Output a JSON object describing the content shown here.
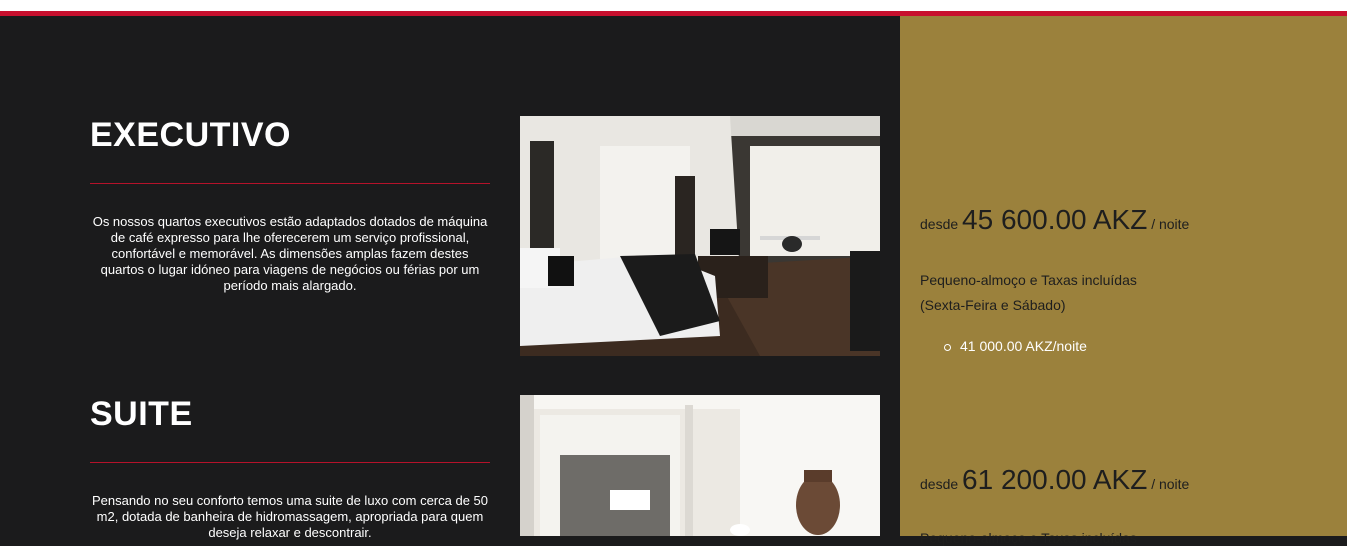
{
  "rooms": [
    {
      "title": "EXECUTIVO",
      "description": "Os nossos quartos executivos estão adaptados dotados de máquina de café expresso para lhe oferecerem um serviço profissional, confortável e memorável. As dimensões amplas fazem destes quartos o lugar idóneo para viagens de negócios ou férias por um período mais alargado.",
      "image_alt": "Executive bedroom",
      "price_prefix": "desde",
      "price": "45 600.00 AKZ",
      "price_suffix": "/ noite",
      "included": "Pequeno-almoço e Taxas incluídas",
      "days": "(Sexta-Feira e Sábado)",
      "special_rate": "41 000.00 AKZ/noite"
    },
    {
      "title": "SUITE",
      "description": "Pensando no seu conforto temos uma suite de luxo com cerca de 50 m2, dotada de banheira de hidromassagem, apropriada para quem deseja relaxar e descontrair.",
      "image_alt": "Suite room",
      "price_prefix": "desde",
      "price": "61 200.00 AKZ",
      "price_suffix": "/ noite",
      "included": "Pequeno-almoço e Taxas incluídas"
    }
  ],
  "colors": {
    "accent_red": "#c8102e",
    "dark_bg": "#1b1b1c",
    "gold_bg": "#9b813c"
  }
}
